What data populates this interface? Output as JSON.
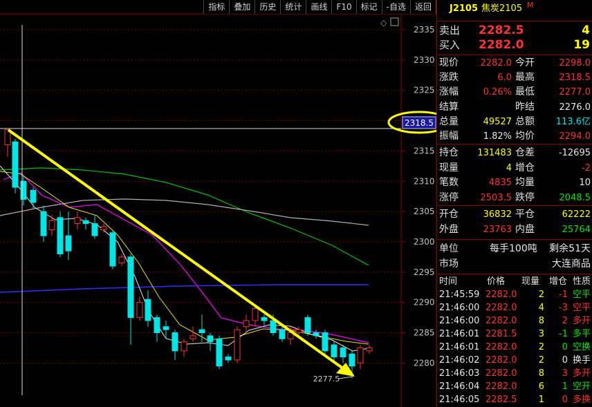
{
  "toolbar": [
    "指标",
    "叠加",
    "历史",
    "统计",
    "画线",
    "F10",
    "标记",
    "-自选",
    "返回"
  ],
  "chart": {
    "y_ticks": [
      "2335",
      "2330",
      "2325",
      "2320",
      "2315",
      "2310",
      "2305",
      "2300",
      "2295",
      "2290",
      "2285",
      "2280"
    ],
    "high_marker": "2318.5",
    "low_marker": "2277.5",
    "diamond_icon": "◇",
    "colors": {
      "up": "#ff3232",
      "down": "#00e6e6",
      "arrow": "#ffff00",
      "ma_white": "#e8e8e8",
      "ma_yellow": "#e8e800",
      "ma_magenta": "#ff00ff",
      "ma_green": "#00c000",
      "ma_gray": "#b0b0b0",
      "ma_blue": "#3030ff"
    }
  },
  "panel": {
    "code": "J2105",
    "name": "焦炭2105",
    "mark": "M",
    "sell_label": "卖出",
    "sell_price": "2282.5",
    "sell_vol": "4",
    "buy_label": "买入",
    "buy_price": "2282.0",
    "buy_vol": "19",
    "quote": [
      {
        "l1": "现价",
        "v1": "2282.0",
        "l2": "今开",
        "v2": "2298.0"
      },
      {
        "l1": "涨跌",
        "v1": "6.0",
        "l2": "最高",
        "v2": "2318.5"
      },
      {
        "l1": "涨幅",
        "v1": "0.26%",
        "l2": "最低",
        "v2": "2277.0"
      },
      {
        "l1": "结算",
        "v1": "",
        "l2": "昨结",
        "v2": "2276.0"
      },
      {
        "l1": "总量",
        "v1": "49527",
        "l2": "总额",
        "v2": "113.6亿"
      },
      {
        "l1": "振幅",
        "v1": "1.82%",
        "l2": "均价",
        "v2": "2294.0"
      }
    ],
    "pos": [
      {
        "l1": "持仓",
        "v1": "131483",
        "l2": "仓差",
        "v2": "-12695"
      },
      {
        "l1": "现量",
        "v1": "4",
        "l2": "增仓",
        "v2": "-2"
      },
      {
        "l1": "笔数",
        "v1": "4835",
        "l2": "均量",
        "v2": "10"
      },
      {
        "l1": "涨停",
        "v1": "2503.5",
        "l2": "跌停",
        "v2": "2048.5"
      }
    ],
    "open": [
      {
        "l1": "开仓",
        "v1": "36832",
        "l2": "平仓",
        "v2": "62222"
      },
      {
        "l1": "外盘",
        "v1": "23763",
        "l2": "内盘",
        "v2": "25764"
      }
    ],
    "unit_label": "单位",
    "unit_value": "每手100吨",
    "remain": "剩余51天",
    "market_label": "市场",
    "market_value": "大连商品",
    "trade_headers": [
      "时间",
      "价格",
      "现量",
      "增仓",
      "性质"
    ],
    "trades": [
      {
        "t": "21:45:59",
        "p": "2282.0",
        "q": "2",
        "d": "-1",
        "n": "空平",
        "nc": "grn",
        "dc": "red"
      },
      {
        "t": "21:46:00",
        "p": "2282.0",
        "q": "4",
        "d": "-3",
        "n": "空平",
        "nc": "red",
        "dc": "red"
      },
      {
        "t": "21:46:00",
        "p": "2282.0",
        "q": "8",
        "d": "2",
        "n": "多开",
        "nc": "red",
        "dc": "red"
      },
      {
        "t": "21:46:01",
        "p": "2281.5",
        "q": "3",
        "d": "-1",
        "n": "多平",
        "nc": "grn",
        "dc": "grn"
      },
      {
        "t": "21:46:01",
        "p": "2282.0",
        "q": "2",
        "d": "0",
        "n": "空换",
        "nc": "grn",
        "dc": "grn"
      },
      {
        "t": "21:46:02",
        "p": "2282.0",
        "q": "2",
        "d": "0",
        "n": "换手",
        "nc": "wht",
        "dc": "wht"
      },
      {
        "t": "21:46:03",
        "p": "2282.0",
        "q": "8",
        "d": "3",
        "n": "多开",
        "nc": "red",
        "dc": "red"
      },
      {
        "t": "21:46:04",
        "p": "2282.0",
        "q": "6",
        "d": "1",
        "n": "空开",
        "nc": "grn",
        "dc": "grn"
      },
      {
        "t": "21:46:05",
        "p": "2282.5",
        "q": "1",
        "d": "0",
        "n": "多换",
        "nc": "red",
        "dc": "red"
      }
    ]
  }
}
